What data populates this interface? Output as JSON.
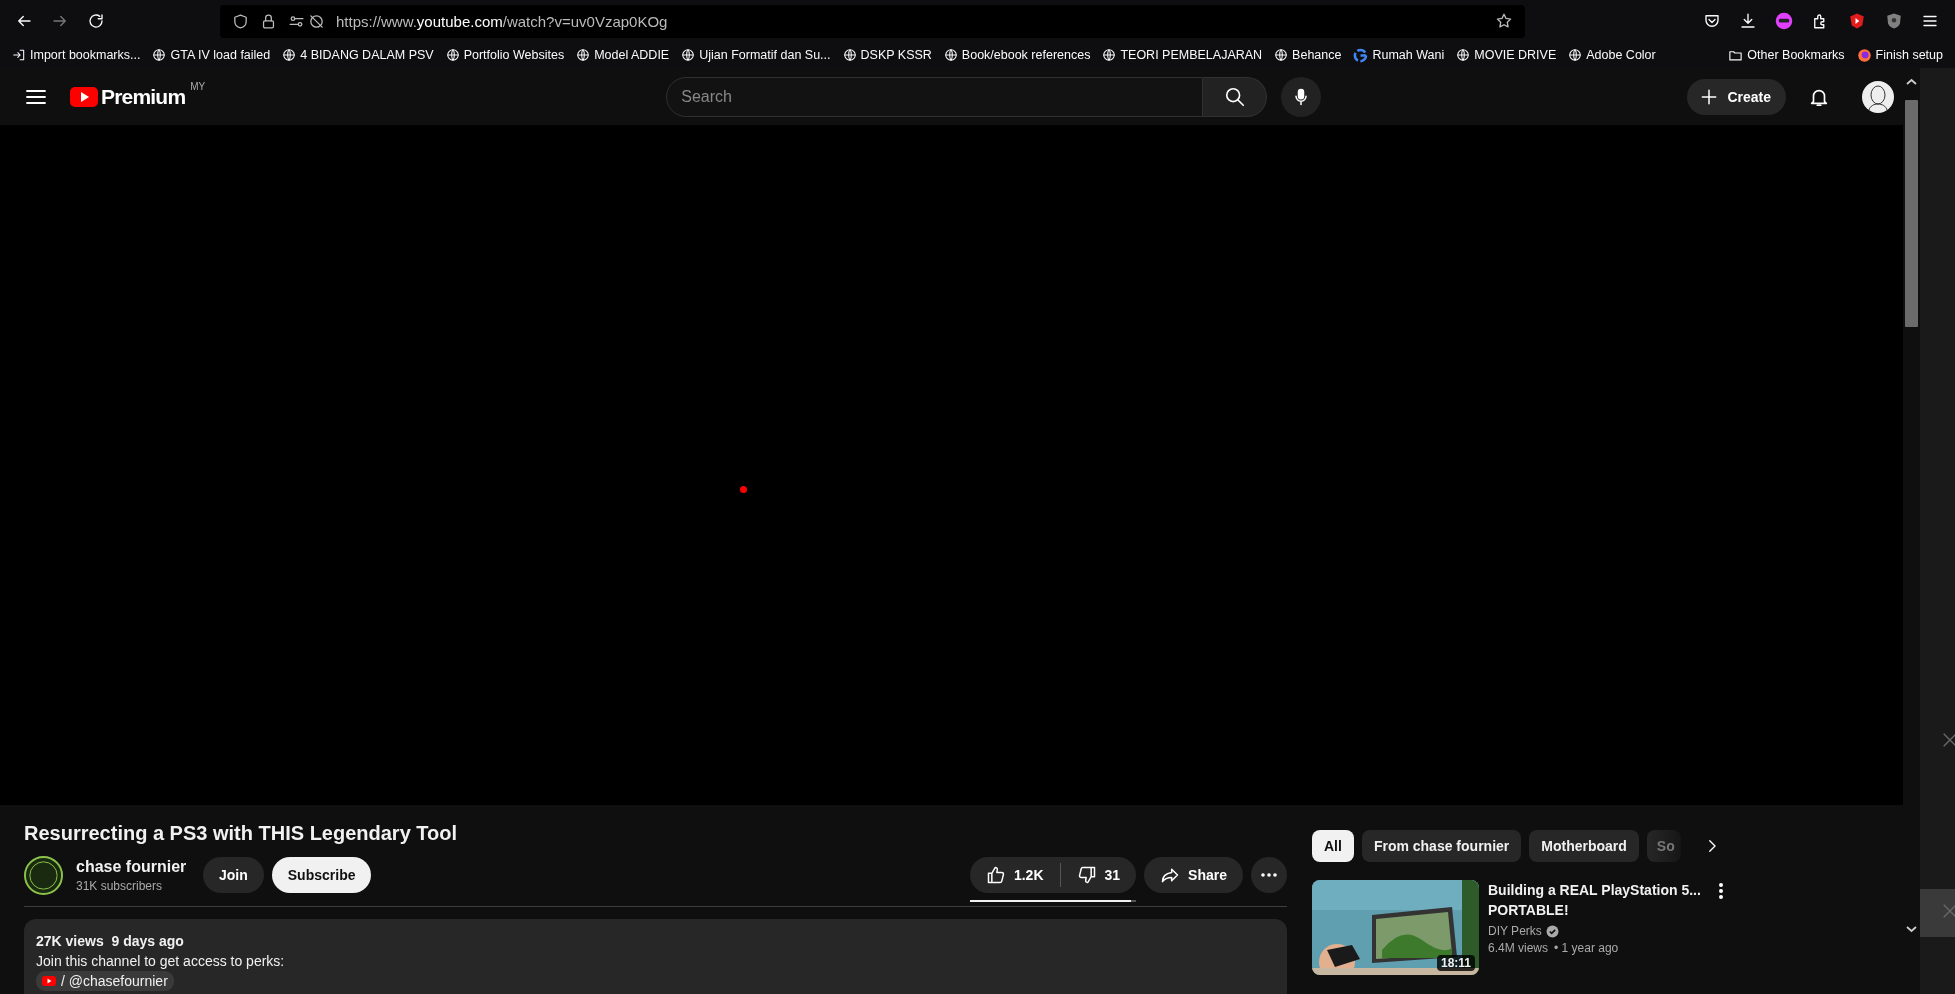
{
  "browser": {
    "url_prefix": "https://www.",
    "url_domain": "youtube.com",
    "url_path": "/watch?v=uv0Vzap0KOg",
    "bookmarks": [
      {
        "label": "Import bookmarks...",
        "kind": "import"
      },
      {
        "label": "GTA IV load failed",
        "kind": "globe"
      },
      {
        "label": "4 BIDANG DALAM PSV",
        "kind": "globe"
      },
      {
        "label": "Portfolio Websites",
        "kind": "globe"
      },
      {
        "label": "Model ADDIE",
        "kind": "globe"
      },
      {
        "label": "Ujian Formatif dan Su...",
        "kind": "globe"
      },
      {
        "label": "DSKP KSSR",
        "kind": "globe"
      },
      {
        "label": "Book/ebook references",
        "kind": "globe"
      },
      {
        "label": "TEORI PEMBELAJARAN",
        "kind": "globe"
      },
      {
        "label": "Behance",
        "kind": "globe"
      },
      {
        "label": "Rumah Wani",
        "kind": "google"
      },
      {
        "label": "MOVIE DRIVE",
        "kind": "globe"
      },
      {
        "label": "Adobe Color",
        "kind": "globe"
      }
    ],
    "bookmarks_right": [
      {
        "label": "Other Bookmarks",
        "kind": "folder"
      },
      {
        "label": "Finish setup",
        "kind": "firefox"
      }
    ]
  },
  "header": {
    "logo": "Premium",
    "region": "MY",
    "search": {
      "placeholder": "Search"
    },
    "create": "Create"
  },
  "video": {
    "title": "Resurrecting a PS3 with THIS Legendary Tool",
    "channel": {
      "name": "chase fournier",
      "subscribers": "31K subscribers"
    },
    "join": "Join",
    "subscribe": "Subscribe",
    "likes": "1.2K",
    "dislikes": "31",
    "like_ratio": {
      "level": 0.97
    },
    "share": "Share",
    "description": {
      "stats": "27K views  9 days ago",
      "text": "Join this channel to get access to perks:",
      "link": "/ @chasefournier"
    }
  },
  "chips": [
    {
      "label": "All",
      "selected": true
    },
    {
      "label": "From chase fournier",
      "selected": false
    },
    {
      "label": "Motherboard",
      "selected": false
    },
    {
      "label": "So",
      "selected": false
    }
  ],
  "related": [
    {
      "title_lines": [
        "Building a REAL PlayStation 5...",
        "PORTABLE!"
      ],
      "channel": "DIY Perks",
      "verified": true,
      "views": "6.4M views",
      "age": "• 1 year ago",
      "duration": "18:11"
    }
  ]
}
